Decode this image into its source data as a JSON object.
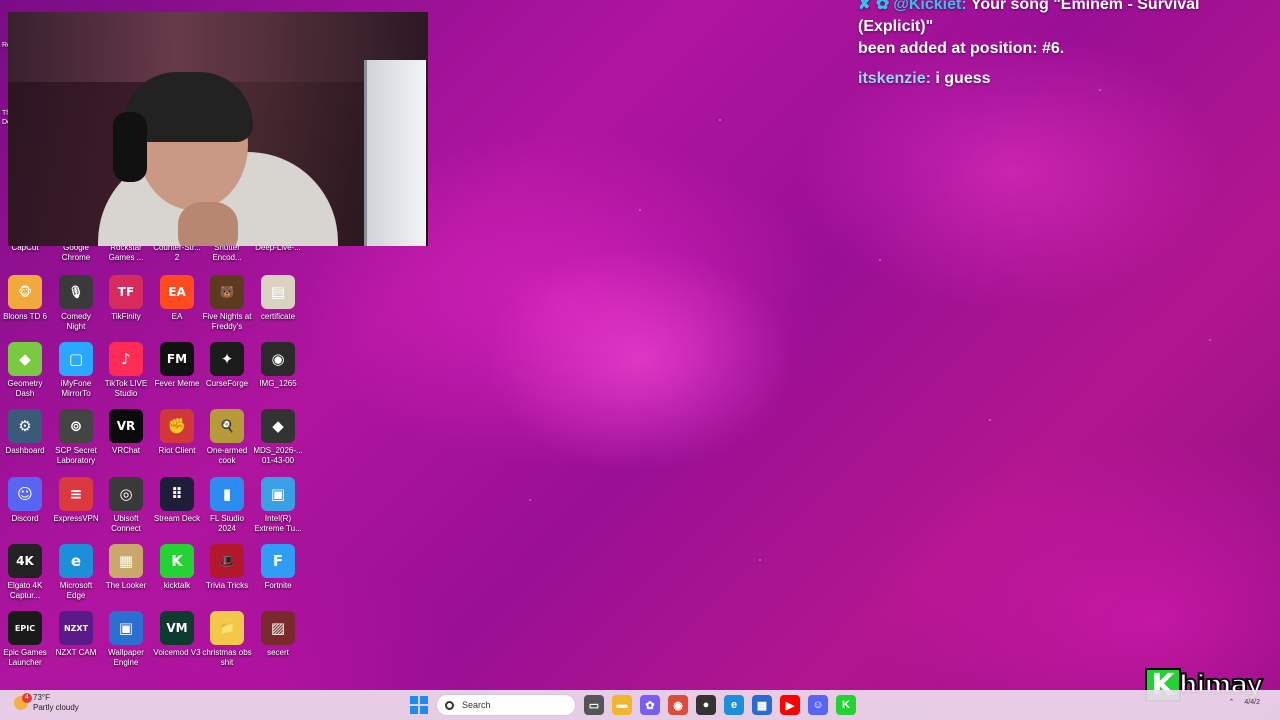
{
  "chat": {
    "line1_user": "@Kickiet:",
    "line1_text": "Your song \"Eminem - Survival (Explicit)\"",
    "line1_cont": "been added at position: #6.",
    "line2_user": "itskenzie:",
    "line2_text": "i guess"
  },
  "left_edge": [
    "Re",
    "The",
    "De"
  ],
  "top_row": [
    {
      "label": "CapCut"
    },
    {
      "label": "Google Chrome"
    },
    {
      "label": "Rockstar Games ..."
    },
    {
      "label": "Counter-Str... 2"
    },
    {
      "label": "Shutter Encod..."
    },
    {
      "label": "Deep-Live-..."
    }
  ],
  "desktop_icons": [
    {
      "label": "Bloons TD 6",
      "glyph": "🐵",
      "color": "#f2a93b"
    },
    {
      "label": "Comedy Night",
      "glyph": "🎙",
      "color": "#3a3a3a"
    },
    {
      "label": "TikFinity",
      "glyph": "TF",
      "color": "#d72b5e"
    },
    {
      "label": "EA",
      "glyph": "EA",
      "color": "#ff4b1f"
    },
    {
      "label": "Five Nights at Freddy's",
      "glyph": "🐻",
      "color": "#5b3a1e"
    },
    {
      "label": "certificate",
      "glyph": "▤",
      "color": "#d9d2c0"
    },
    {
      "label": "Geometry Dash",
      "glyph": "◆",
      "color": "#7ac943"
    },
    {
      "label": "iMyFone MirrorTo",
      "glyph": "▢",
      "color": "#2aa7ff"
    },
    {
      "label": "TikTok LIVE Studio",
      "glyph": "♪",
      "color": "#fe2c55"
    },
    {
      "label": "Fever Meme",
      "glyph": "FM",
      "color": "#111111"
    },
    {
      "label": "CurseForge",
      "glyph": "✦",
      "color": "#1b1b1b"
    },
    {
      "label": "IMG_1265",
      "glyph": "◉",
      "color": "#2a2a2a"
    },
    {
      "label": "Dashboard",
      "glyph": "⚙",
      "color": "#3b5a7a"
    },
    {
      "label": "SCP Secret Laboratory",
      "glyph": "⊚",
      "color": "#444444"
    },
    {
      "label": "VRChat",
      "glyph": "VR",
      "color": "#0b0b0b"
    },
    {
      "label": "Riot Client",
      "glyph": "✊",
      "color": "#d13639"
    },
    {
      "label": "One-armed cook",
      "glyph": "🍳",
      "color": "#b89a3a"
    },
    {
      "label": "MDS_2026-... 01-43-00",
      "glyph": "◆",
      "color": "#333333"
    },
    {
      "label": "Discord",
      "glyph": "☺",
      "color": "#5865f2"
    },
    {
      "label": "ExpressVPN",
      "glyph": "≡",
      "color": "#da3940"
    },
    {
      "label": "Ubisoft Connect",
      "glyph": "◎",
      "color": "#3a3a3a"
    },
    {
      "label": "Stream Deck",
      "glyph": "⠿",
      "color": "#1e1e3a"
    },
    {
      "label": "FL Studio 2024",
      "glyph": "▮",
      "color": "#2d8cf0"
    },
    {
      "label": "Intel(R) Extreme Tu...",
      "glyph": "▣",
      "color": "#3aa0e6"
    },
    {
      "label": "Elgato 4K Captur...",
      "glyph": "4K",
      "color": "#222222"
    },
    {
      "label": "Microsoft Edge",
      "glyph": "e",
      "color": "#1b8fd8"
    },
    {
      "label": "The Looker",
      "glyph": "▦",
      "color": "#c9a86a"
    },
    {
      "label": "kicktalk",
      "glyph": "K",
      "color": "#23d334"
    },
    {
      "label": "Trivia Tricks",
      "glyph": "🎩",
      "color": "#b2182b"
    },
    {
      "label": "Fortnite",
      "glyph": "F",
      "color": "#2f9cf5"
    },
    {
      "label": "Epic Games Launcher",
      "glyph": "EPIC",
      "color": "#1a1a1a"
    },
    {
      "label": "NZXT CAM",
      "glyph": "NZXT",
      "color": "#5a1a8a"
    },
    {
      "label": "Wallpaper Engine",
      "glyph": "▣",
      "color": "#2b6fd1"
    },
    {
      "label": "Voicemod V3",
      "glyph": "VM",
      "color": "#0d3b2e"
    },
    {
      "label": "christmas obs shit",
      "glyph": "📁",
      "color": "#f3c84a"
    },
    {
      "label": "secert",
      "glyph": "▨",
      "color": "#7a2a2a"
    }
  ],
  "watermark": {
    "letter": "K",
    "text": "himay"
  },
  "taskbar": {
    "weather_temp": "73°F",
    "weather_desc": "Partly cloudy",
    "weather_badge": "4",
    "search_placeholder": "Search",
    "date_fragment": "4/4/2"
  }
}
